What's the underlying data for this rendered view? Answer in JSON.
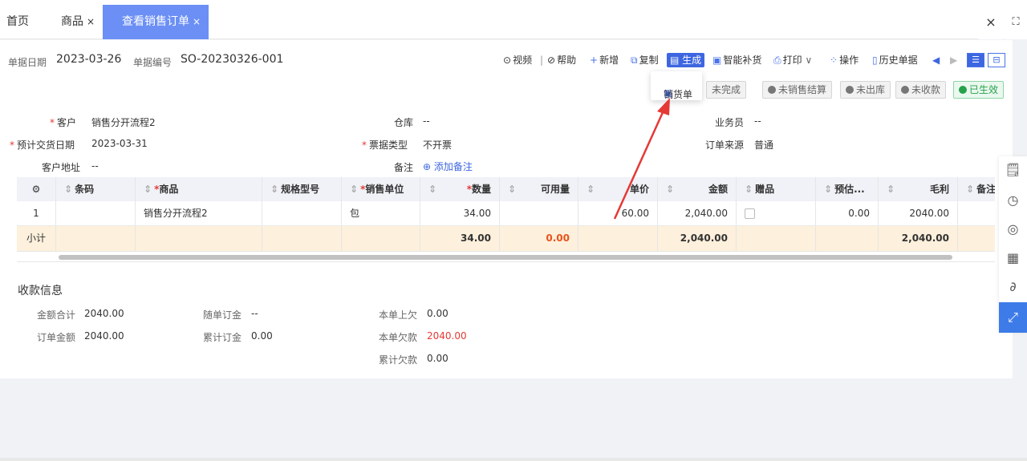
{
  "tabs": [
    {
      "label": "首页",
      "close": ""
    },
    {
      "label": "商品",
      "close": "×"
    },
    {
      "label": "查看销售订单",
      "close": "×"
    }
  ],
  "tab_actions": {
    "close": "×",
    "fullscreen": "⛶"
  },
  "header": {
    "date_label": "单据日期",
    "date_value": "2023-03-26",
    "number_label": "单据编号",
    "number_value": "SO-20230326-001"
  },
  "toolbar": {
    "video": "视频",
    "sep": "|",
    "help": "帮助",
    "add": "新增",
    "copy": "复制",
    "generate": "生成",
    "replenish": "智能补货",
    "print": "打印",
    "print_caret": "∨",
    "operate": "操作",
    "history": "历史单据"
  },
  "dropdown": {
    "item": "销货单"
  },
  "status_badges": [
    {
      "label": "未完成",
      "state": "off"
    },
    {
      "label": "未销售结算",
      "state": "off"
    },
    {
      "label": "未出库",
      "state": "off"
    },
    {
      "label": "未收款",
      "state": "off"
    },
    {
      "label": "已生效",
      "state": "ok"
    }
  ],
  "form": {
    "customer_label": "客户",
    "customer_value": "销售分开流程2",
    "warehouse_label": "仓库",
    "warehouse_value": "--",
    "salesman_label": "业务员",
    "salesman_value": "--",
    "delivery_label": "预计交货日期",
    "delivery_value": "2023-03-31",
    "invoice_label": "票据类型",
    "invoice_value": "不开票",
    "source_label": "订单来源",
    "source_value": "普通",
    "address_label": "客户地址",
    "address_value": "--",
    "remark_label": "备注",
    "remark_link": "添加备注"
  },
  "table": {
    "headers": {
      "barcode": "条码",
      "product": "商品",
      "spec": "规格型号",
      "unit": "销售单位",
      "qty": "数量",
      "available": "可用量",
      "price": "单价",
      "amount": "金额",
      "gift": "赠品",
      "estimate": "预估...",
      "profit": "毛利",
      "remark": "备注"
    },
    "row": {
      "index": "1",
      "barcode": "",
      "product": "销售分开流程2",
      "spec": "",
      "unit": "包",
      "qty": "34.00",
      "available": "",
      "price": "60.00",
      "amount": "2,040.00",
      "estimate": "0.00",
      "profit": "2040.00"
    },
    "subtotal": {
      "label": "小计",
      "qty": "34.00",
      "available": "0.00",
      "amount": "2,040.00",
      "profit": "2,040.00"
    }
  },
  "payment": {
    "title": "收款信息",
    "total_label": "金额合计",
    "total_value": "2040.00",
    "with_deposit_label": "随单订金",
    "with_deposit_value": "--",
    "prev_owed_label": "本单上欠",
    "prev_owed_value": "0.00",
    "order_amount_label": "订单金额",
    "order_amount_value": "2040.00",
    "acc_deposit_label": "累计订金",
    "acc_deposit_value": "0.00",
    "this_owed_label": "本单欠款",
    "this_owed_value": "2040.00",
    "acc_owed_label": "累计欠款",
    "acc_owed_value": "0.00"
  },
  "colors": {
    "accent": "#3d66e0",
    "tab_active": "#6b8ff5",
    "danger": "#e53935",
    "success": "#27a24a",
    "arrow": "#e53935"
  }
}
